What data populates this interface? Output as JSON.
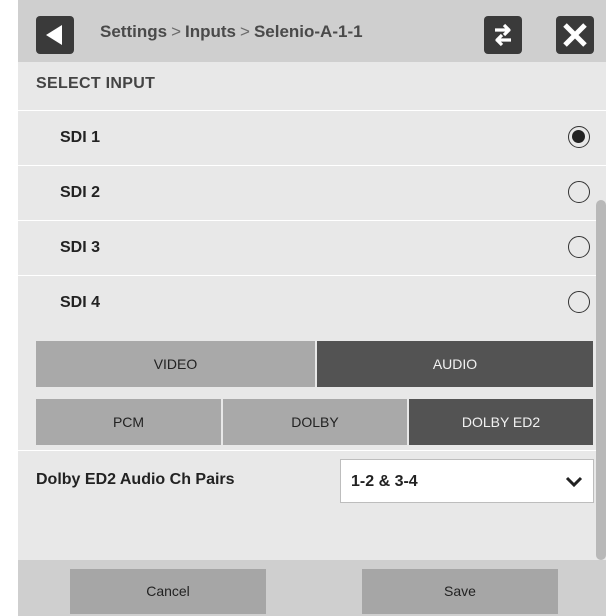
{
  "header": {
    "breadcrumb": [
      "Settings",
      "Inputs",
      "Selenio-A-1-1"
    ],
    "separator": ">"
  },
  "section_title": "SELECT INPUT",
  "inputs": [
    {
      "label": "SDI 1",
      "selected": true
    },
    {
      "label": "SDI 2",
      "selected": false
    },
    {
      "label": "SDI 3",
      "selected": false
    },
    {
      "label": "SDI 4",
      "selected": false
    }
  ],
  "tabs": {
    "video": "VIDEO",
    "audio": "AUDIO",
    "active": "audio"
  },
  "audio_types": {
    "pcm": "PCM",
    "dolby": "DOLBY",
    "dolby_ed2": "DOLBY ED2",
    "active": "dolby_ed2"
  },
  "dolby_ed2": {
    "label": "Dolby ED2 Audio Ch Pairs",
    "value": "1-2 & 3-4"
  },
  "footer": {
    "cancel": "Cancel",
    "save": "Save"
  },
  "colors": {
    "active_segment": "#535353",
    "inactive_segment": "#a9a9a9"
  }
}
